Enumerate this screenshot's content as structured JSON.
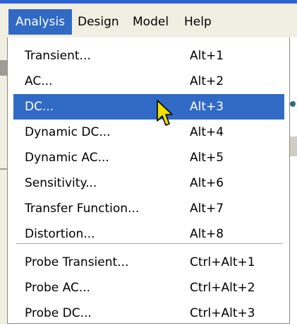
{
  "menubar": {
    "items": [
      {
        "label": "Analysis",
        "active": true
      },
      {
        "label": "Design"
      },
      {
        "label": "Model"
      },
      {
        "label": "Help"
      }
    ]
  },
  "menu": {
    "items": [
      {
        "label": "Transient...",
        "shortcut": "Alt+1"
      },
      {
        "label": "AC...",
        "shortcut": "Alt+2"
      },
      {
        "label": "DC...",
        "shortcut": "Alt+3",
        "highlighted": true
      },
      {
        "label": "Dynamic DC...",
        "shortcut": "Alt+4"
      },
      {
        "label": "Dynamic AC...",
        "shortcut": "Alt+5"
      },
      {
        "label": "Sensitivity...",
        "shortcut": "Alt+6"
      },
      {
        "label": "Transfer Function...",
        "shortcut": "Alt+7"
      },
      {
        "label": "Distortion...",
        "shortcut": "Alt+8"
      },
      {
        "label": "Probe Transient...",
        "shortcut": "Ctrl+Alt+1"
      },
      {
        "label": "Probe AC...",
        "shortcut": "Ctrl+Alt+2"
      },
      {
        "label": "Probe DC...",
        "shortcut": "Ctrl+Alt+3"
      }
    ]
  },
  "colors": {
    "highlight": "#316ac5",
    "menubar_bg": "#f1efe2",
    "title_strip": "#2d63d3",
    "cursor": "#f0e000"
  },
  "cursor": {
    "icon": "arrow-pointer-icon"
  }
}
